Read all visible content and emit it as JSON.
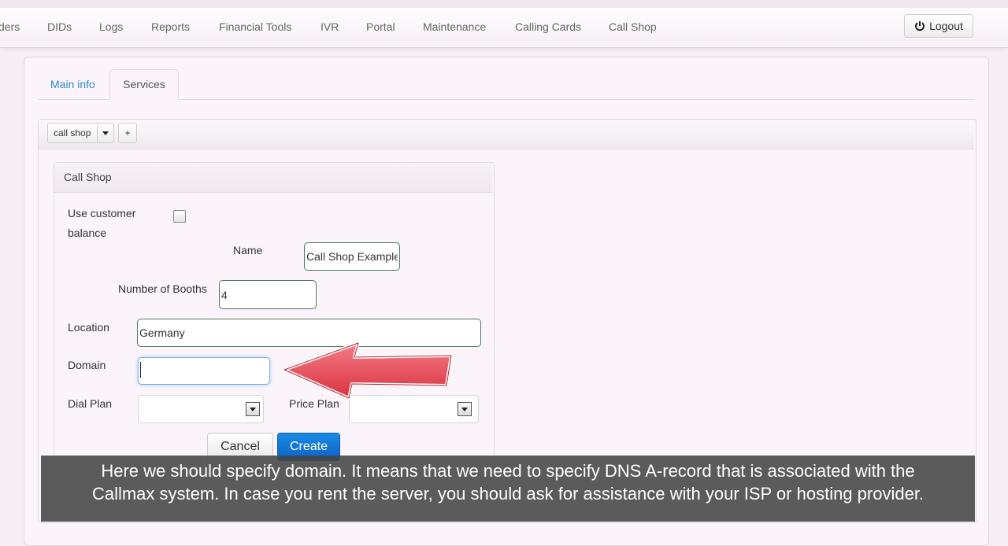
{
  "nav": {
    "items": [
      "ders",
      "DIDs",
      "Logs",
      "Reports",
      "Financial Tools",
      "IVR",
      "Portal",
      "Maintenance",
      "Calling Cards",
      "Call Shop"
    ],
    "logout_label": "Logout"
  },
  "tabs": {
    "main_info": "Main info",
    "services": "Services"
  },
  "toolbar": {
    "service_select_value": "call shop",
    "add_label": "+"
  },
  "form": {
    "title": "Call Shop",
    "use_customer_balance_label_1": "Use customer",
    "use_customer_balance_label_2": "balance",
    "use_customer_balance_checked": false,
    "name_label": "Name",
    "name_value": "Call Shop Example",
    "booths_label": "Number of Booths",
    "booths_value": "4",
    "location_label": "Location",
    "location_value": "Germany",
    "domain_label": "Domain",
    "domain_value": "",
    "dial_plan_label": "Dial Plan",
    "dial_plan_value": "",
    "price_plan_label": "Price Plan",
    "price_plan_value": "",
    "cancel_label": "Cancel",
    "create_label": "Create"
  },
  "caption": {
    "line1": "Here we should specify domain. It means that we need to specify DNS A-record that is associated with the",
    "line2": "Callmax system. In case you rent the server, you should ask for assistance with your ISP or hosting provider."
  },
  "colors": {
    "accent_blue": "#0b62c4",
    "tab_link": "#2a8bd0",
    "arrow_red": "#e0404f"
  }
}
